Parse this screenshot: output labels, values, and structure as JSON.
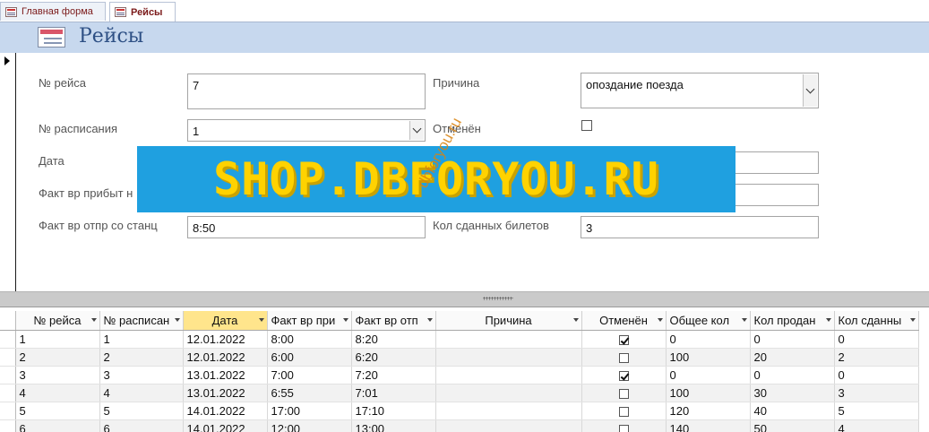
{
  "tabs": [
    {
      "label": "Главная форма",
      "active": false
    },
    {
      "label": "Рейсы",
      "active": true
    }
  ],
  "form": {
    "title": "Рейсы",
    "labels": {
      "flight_no": "№ рейса",
      "schedule_no": "№ расписания",
      "date": "Дата",
      "fact_arrival": "Факт вр прибыт н",
      "fact_departure": "Факт вр отпр со станц",
      "reason": "Причина",
      "cancelled": "Отменён",
      "returned_tickets": "Кол сданных билетов"
    },
    "values": {
      "flight_no": "7",
      "schedule_no": "1",
      "date": "",
      "fact_arrival": "",
      "fact_departure": "8:50",
      "reason": "опоздание поезда",
      "cancelled": false,
      "field_right_1": "",
      "field_right_2": "",
      "returned_tickets": "3"
    }
  },
  "watermark": {
    "banner": "SHOP.DBFORYOU.RU",
    "diagonal": "dbforyou.ru"
  },
  "grid": {
    "columns": [
      {
        "label": "№ рейса",
        "filter": true
      },
      {
        "label": "№ расписан",
        "filter": true
      },
      {
        "label": "Дата",
        "filter": true,
        "sorted": true
      },
      {
        "label": "Факт вр при",
        "filter": true
      },
      {
        "label": "Факт вр отп",
        "filter": true
      },
      {
        "label": "Причина",
        "filter": true
      },
      {
        "label": "Отменён",
        "filter": true
      },
      {
        "label": "Общее кол",
        "filter": true
      },
      {
        "label": "Кол продан",
        "filter": true
      },
      {
        "label": "Кол сданны",
        "filter": true
      }
    ],
    "rows": [
      [
        "1",
        "1",
        "12.01.2022",
        "8:00",
        "8:20",
        "",
        true,
        "0",
        "0",
        "0"
      ],
      [
        "2",
        "2",
        "12.01.2022",
        "6:00",
        "6:20",
        "",
        false,
        "100",
        "20",
        "2"
      ],
      [
        "3",
        "3",
        "13.01.2022",
        "7:00",
        "7:20",
        "",
        true,
        "0",
        "0",
        "0"
      ],
      [
        "4",
        "4",
        "13.01.2022",
        "6:55",
        "7:01",
        "",
        false,
        "100",
        "30",
        "3"
      ],
      [
        "5",
        "5",
        "14.01.2022",
        "17:00",
        "17:10",
        "",
        false,
        "120",
        "40",
        "5"
      ],
      [
        "6",
        "6",
        "14.01.2022",
        "12:00",
        "13:00",
        "",
        false,
        "140",
        "50",
        "4"
      ]
    ]
  },
  "colors": {
    "header_band": "#c7d8ee",
    "title_text": "#2d4f84",
    "watermark_banner": "#1fa0e0",
    "watermark_text": "#ffd200",
    "sorted_column": "#ffe58c"
  }
}
